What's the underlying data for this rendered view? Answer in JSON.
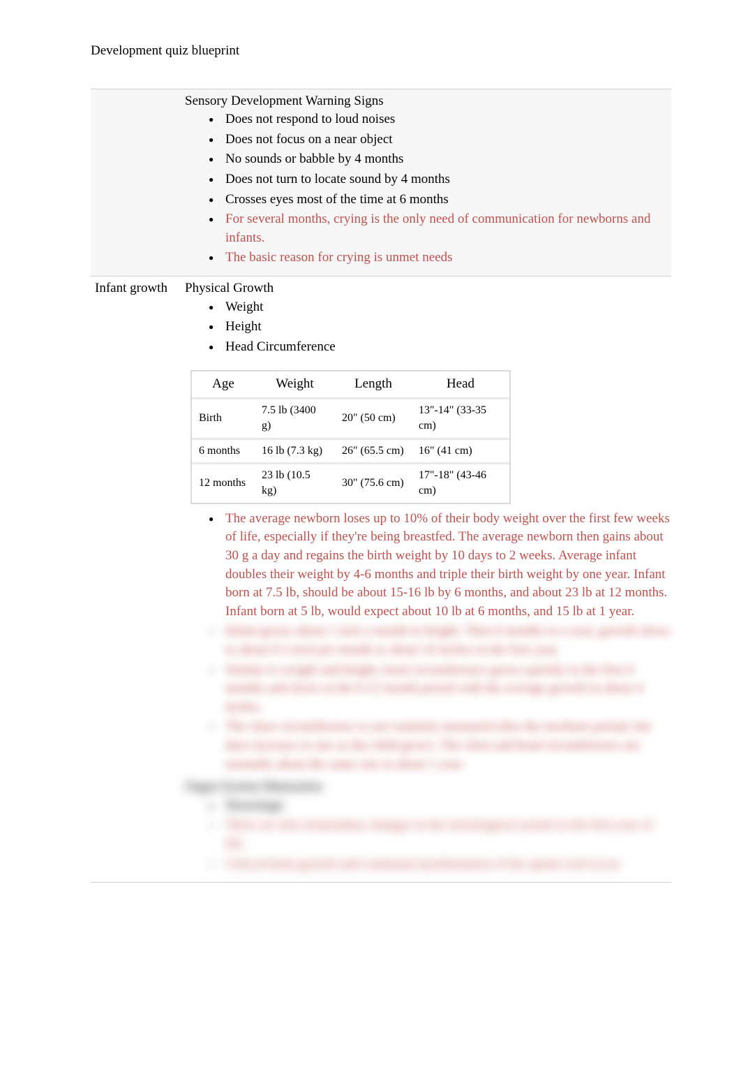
{
  "title": "Development quiz blueprint",
  "row1": {
    "heading": "Sensory Development Warning Signs",
    "bullets": [
      {
        "text": "Does not respond to loud noises",
        "red": false
      },
      {
        "text": "Does not focus on a near object",
        "red": false
      },
      {
        "text": "No sounds or babble by 4 months",
        "red": false
      },
      {
        "text": "Does not turn to locate sound by 4 months",
        "red": false
      },
      {
        "text": "Crosses eyes most of the time at 6 months",
        "red": false
      },
      {
        "text": "For several months, crying is the only need of communication for newborns and infants.",
        "red": true
      },
      {
        "text": "The basic reason for crying is unmet needs",
        "red": true
      }
    ]
  },
  "row2": {
    "left": "Infant growth",
    "heading": "Physical Growth",
    "bullets": [
      "Weight",
      "Height",
      "Head Circumference"
    ],
    "table": {
      "headers": [
        "Age",
        "Weight",
        "Length",
        "Head"
      ],
      "rows": [
        [
          "Birth",
          "7.5 lb (3400 g)",
          "20\" (50 cm)",
          "13\"-14\" (33-35 cm)"
        ],
        [
          "6 months",
          "16 lb (7.3 kg)",
          "26\" (65.5 cm)",
          "16\" (41 cm)"
        ],
        [
          "12 months",
          "23 lb (10.5 kg)",
          "30\" (75.6 cm)",
          "17\"-18\" (43-46 cm)"
        ]
      ]
    },
    "after_bullets": [
      "The average newborn loses up to 10% of their body weight over the first few weeks of life, especially if they're being breastfed. The average newborn then gains about 30 g a day and regains the birth weight by 10 days to 2 weeks. Average infant doubles their weight by 4-6 months and triple their birth weight by one year. Infant born at 7.5 lb, should be about 15-16 lb by 6 months, and about 23 lb at 12 months. Infant born at 5 lb, would expect about 10 lb at 6 months, and 15 lb at 1 year."
    ],
    "blurred_bullets": [
      "Infant grows about 1 inch a month in height. Then 6 months to a year, growth slows to about 0.5 inch per month or about 10 inches in the first year.",
      "Similar to weight and height, head circumference grows quickly in the first 6 months and slows at the 6-12 month period with the average growth in about 4 inches.",
      "The chest circumference is not routinely measured after the newborn period, but does increase in size as the child grows. The chest and head circumference are normally about the same size at about 1 year."
    ],
    "blurred_heading": "Organ System Maturation",
    "blurred_sub": "Neurologic",
    "blurred_sub_bullets": [
      "There are also tremendous changes in the neurological system in the first year of life.",
      "Critical brain growth and continued myelinization of the spinal cord occur."
    ]
  }
}
